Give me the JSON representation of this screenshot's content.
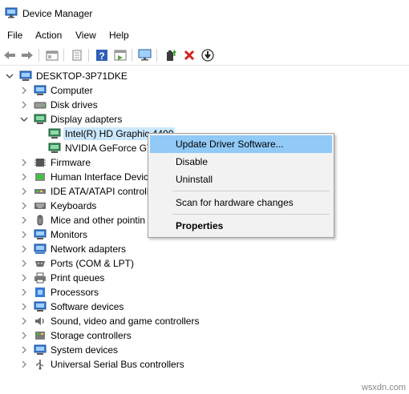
{
  "window": {
    "title": "Device Manager"
  },
  "menu": [
    "File",
    "Action",
    "View",
    "Help"
  ],
  "toolbar_icons": [
    "back-icon",
    "forward-icon",
    "properties-view-icon",
    "print-icon",
    "help-icon",
    "show-hidden-icon",
    "monitor-scan-icon",
    "update-driver-icon",
    "uninstall-x-icon",
    "download-icon"
  ],
  "tree": {
    "root": "DESKTOP-3P71DKE",
    "items": [
      {
        "label": "Computer",
        "expanded": false
      },
      {
        "label": "Disk drives",
        "expanded": false
      },
      {
        "label": "Display adapters",
        "expanded": true,
        "children": [
          "Intel(R) HD Graphic 4400",
          "NVIDIA GeForce GT"
        ]
      },
      {
        "label": "Firmware",
        "expanded": false
      },
      {
        "label": "Human Interface Devic",
        "expanded": false
      },
      {
        "label": "IDE ATA/ATAPI controll",
        "expanded": false
      },
      {
        "label": "Keyboards",
        "expanded": false
      },
      {
        "label": "Mice and other pointin",
        "expanded": false
      },
      {
        "label": "Monitors",
        "expanded": false
      },
      {
        "label": "Network adapters",
        "expanded": false
      },
      {
        "label": "Ports (COM & LPT)",
        "expanded": false
      },
      {
        "label": "Print queues",
        "expanded": false
      },
      {
        "label": "Processors",
        "expanded": false
      },
      {
        "label": "Software devices",
        "expanded": false
      },
      {
        "label": "Sound, video and game controllers",
        "expanded": false
      },
      {
        "label": "Storage controllers",
        "expanded": false
      },
      {
        "label": "System devices",
        "expanded": false
      },
      {
        "label": "Universal Serial Bus controllers",
        "expanded": false
      }
    ]
  },
  "context_menu": {
    "items": [
      "Update Driver Software...",
      "Disable",
      "Uninstall",
      "Scan for hardware changes",
      "Properties"
    ],
    "highlighted": "Update Driver Software...",
    "bold": "Properties"
  },
  "watermark": "wsxdn.com",
  "colors": {
    "selection": "#cce8ff",
    "menu_highlight": "#91c9f7",
    "menu_bg": "#f2f2f2"
  }
}
